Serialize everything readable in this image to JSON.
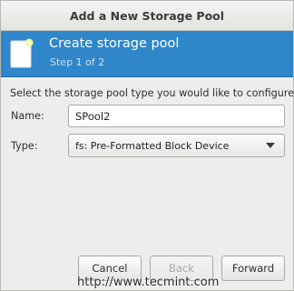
{
  "window": {
    "title": "Add a New Storage Pool"
  },
  "banner": {
    "title": "Create storage pool",
    "step": "Step 1 of 2",
    "icon": "storage-pool-icon",
    "background_color": "#2f86c9"
  },
  "form": {
    "prompt": "Select the storage pool type you would like to configure.",
    "name_label": "Name:",
    "name_value": "SPool2",
    "type_label": "Type:",
    "type_value": "fs: Pre-Formatted Block Device"
  },
  "buttons": {
    "cancel": "Cancel",
    "back": "Back",
    "forward": "Forward"
  },
  "watermark": "http://www.tecmint.com"
}
